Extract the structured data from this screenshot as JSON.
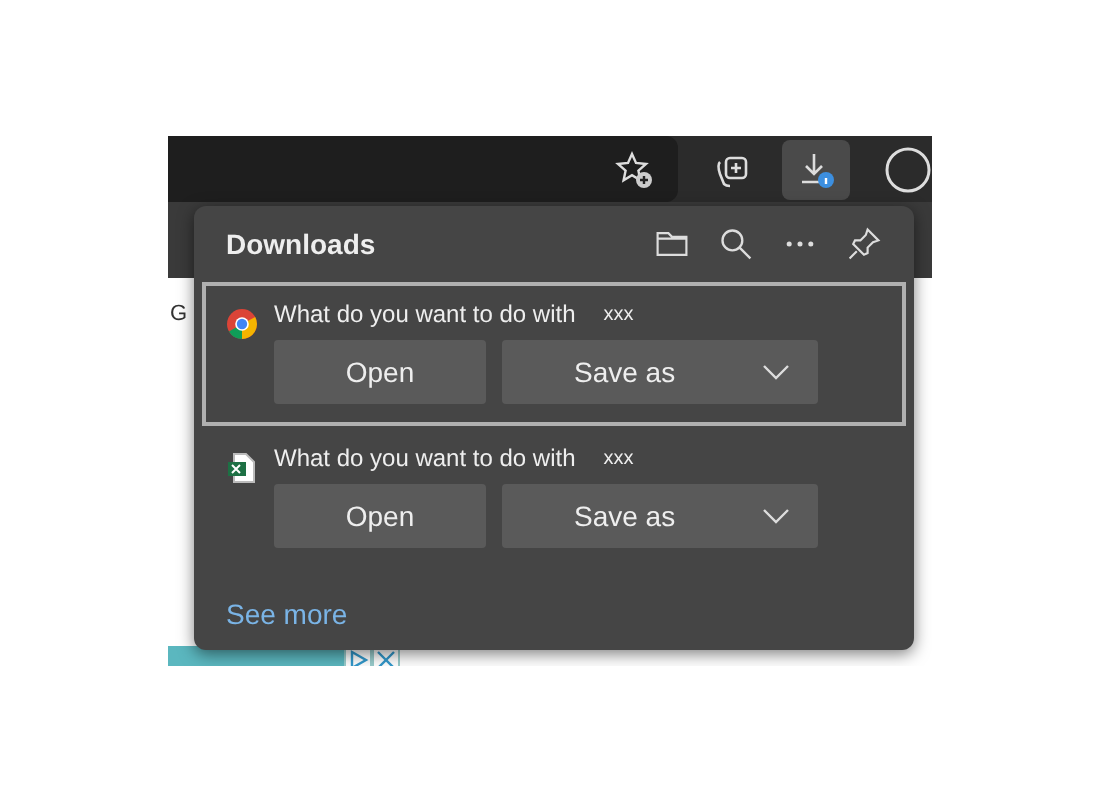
{
  "page_text": "G",
  "panel": {
    "title": "Downloads"
  },
  "downloads": [
    {
      "kind": "chrome",
      "prompt": "What do you want to do with",
      "file": "xxx",
      "selected": true,
      "open": "Open",
      "save": "Save as"
    },
    {
      "kind": "excel",
      "prompt": "What do you want to do with",
      "file": "xxx",
      "selected": false,
      "open": "Open",
      "save": "Save as"
    }
  ],
  "see_more": "See more"
}
